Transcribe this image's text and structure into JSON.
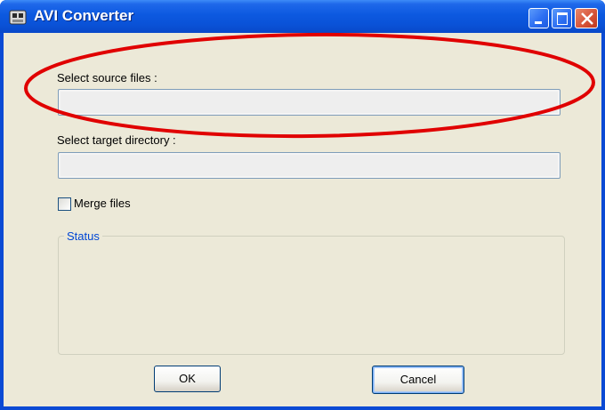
{
  "window": {
    "title": "AVI Converter"
  },
  "form": {
    "source_label": "Select source files :",
    "source_value": "",
    "target_label": "Select target directory :",
    "target_value": "",
    "merge_label": "Merge files",
    "merge_checked": false,
    "status_title": "Status"
  },
  "buttons": {
    "ok": "OK",
    "cancel": "Cancel"
  },
  "icons": {
    "app": "app-icon",
    "minimize": "minimize-icon",
    "maximize": "maximize-icon",
    "close": "close-icon"
  },
  "colors": {
    "titlebar": "#0a52d7",
    "client_bg": "#ece9d8",
    "status_title": "#0046d5",
    "annotation": "#e00000"
  }
}
